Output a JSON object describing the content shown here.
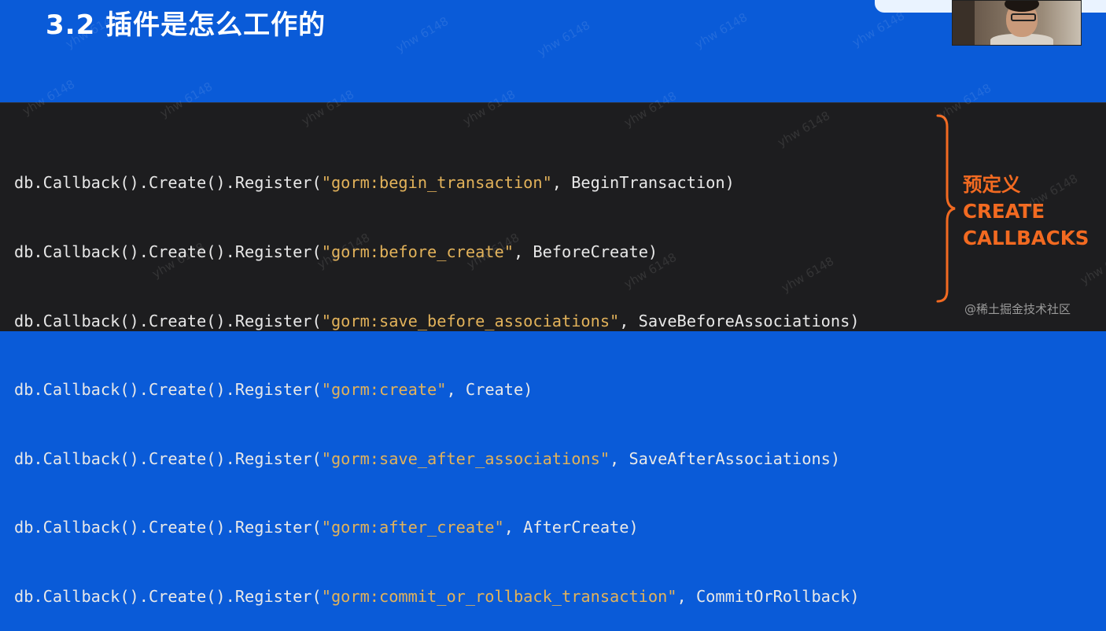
{
  "slide": {
    "title": "3.2 插件是怎么工作的"
  },
  "code": {
    "lines": [
      {
        "prefix": "db.Callback().Create().Register(",
        "string": "\"gorm:begin_transaction\"",
        "suffix": ", BeginTransaction)"
      },
      {
        "prefix": "db.Callback().Create().Register(",
        "string": "\"gorm:before_create\"",
        "suffix": ", BeforeCreate)"
      },
      {
        "prefix": "db.Callback().Create().Register(",
        "string": "\"gorm:save_before_associations\"",
        "suffix": ", SaveBeforeAssociations)"
      },
      {
        "prefix": "db.Callback().Create().Register(",
        "string": "\"gorm:create\"",
        "suffix": ", Create)"
      },
      {
        "prefix": "db.Callback().Create().Register(",
        "string": "\"gorm:save_after_associations\"",
        "suffix": ", SaveAfterAssociations)"
      },
      {
        "prefix": "db.Callback().Create().Register(",
        "string": "\"gorm:after_create\"",
        "suffix": ", AfterCreate)"
      },
      {
        "prefix": "db.Callback().Create().Register(",
        "string": "\"gorm:commit_or_rollback_transaction\"",
        "suffix": ", CommitOrRollback)"
      }
    ]
  },
  "annotation": {
    "line1": "预定义",
    "line2": "CREATE",
    "line3": "CALLBACKS"
  },
  "footer": {
    "credit": "@稀土掘金技术社区"
  },
  "watermark": {
    "text": "yhw 6148"
  },
  "colors": {
    "background": "#0a5bd8",
    "code_background": "#1d1d1f",
    "string": "#e2b25a",
    "annotation": "#f26a21"
  }
}
